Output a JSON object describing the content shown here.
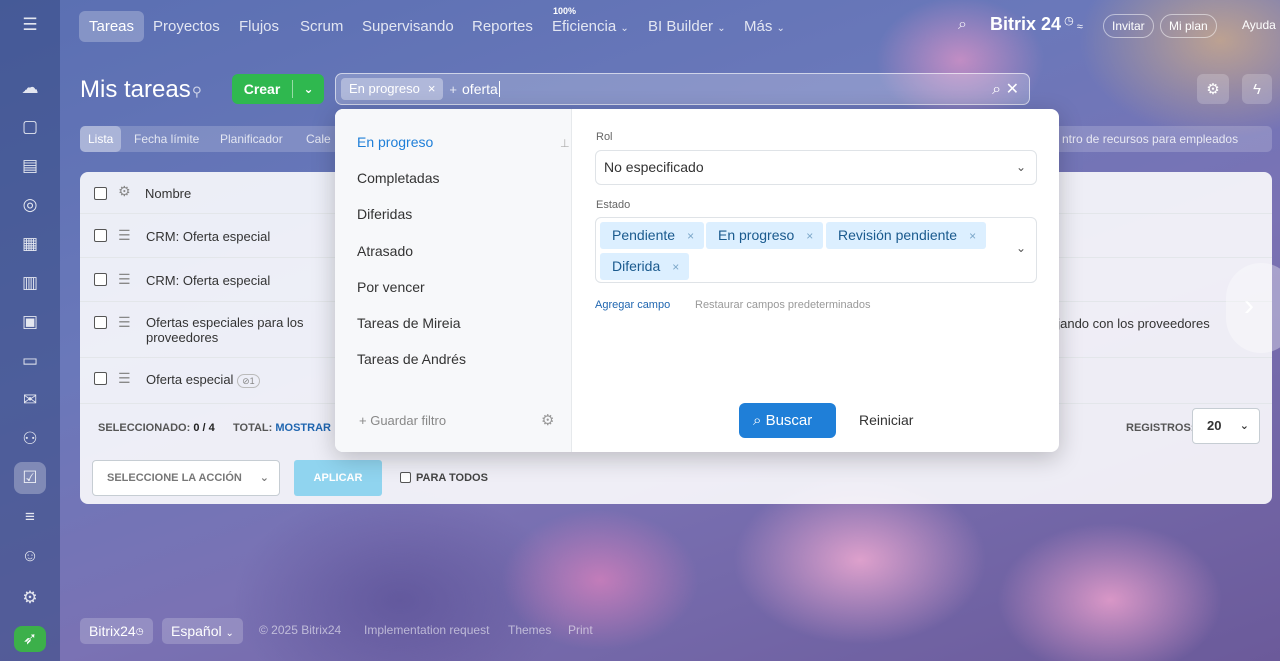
{
  "sidebar": {
    "icons": [
      "menu-icon",
      "chat-icon",
      "messages-icon",
      "feed-icon",
      "crm-icon",
      "calendar-icon",
      "docs-icon",
      "board-icon",
      "payment-icon",
      "mail-icon",
      "contacts-icon",
      "tasks-icon",
      "automation-icon",
      "robot-icon",
      "settings-icon",
      "launch-icon"
    ]
  },
  "topnav": {
    "items": [
      "Tareas",
      "Proyectos",
      "Flujos",
      "Scrum",
      "Supervisando",
      "Reportes",
      "Eficiencia",
      "BI Builder",
      "Más"
    ],
    "efficiency_badge": "100%",
    "brand": "Bitrix 24",
    "invite": "Invitar",
    "plan": "Mi plan",
    "help": "Ayuda"
  },
  "header": {
    "title": "Mis tareas",
    "create": "Crear"
  },
  "search": {
    "chip": "En progreso",
    "plus": "+",
    "query": "oferta"
  },
  "subtabs": {
    "items": [
      "Lista",
      "Fecha límite",
      "Planificador",
      "Cale"
    ],
    "right_text": "ntro de recursos para empleados"
  },
  "grid": {
    "header": "Nombre",
    "rows": [
      {
        "name": "CRM: Oferta especial"
      },
      {
        "name": "CRM: Oferta especial"
      },
      {
        "name": "Ofertas especiales para los proveedores"
      },
      {
        "name": "Oferta especial",
        "badge": "1"
      }
    ],
    "right_peek": "ajando con los proveedores",
    "selected_label": "SELECCIONADO:",
    "selected_value": "0 / 4",
    "total_label": "TOTAL:",
    "total_link": "MOSTRAR",
    "records_label": "REGISTROS:",
    "records_value": "20",
    "action_select": "SELECCIONE LA ACCIÓN",
    "apply": "APLICAR",
    "for_all": "PARA TODOS"
  },
  "filter": {
    "presets": [
      "En progreso",
      "Completadas",
      "Diferidas",
      "Atrasado",
      "Por vencer",
      "Tareas de Mireia",
      "Tareas de Andrés"
    ],
    "active_preset": "En progreso",
    "save_filter": "Guardar filtro",
    "role_label": "Rol",
    "role_value": "No especificado",
    "status_label": "Estado",
    "status_tags": [
      "Pendiente",
      "En progreso",
      "Revisión pendiente",
      "Diferida"
    ],
    "add_field": "Agregar campo",
    "restore_fields": "Restaurar campos predeterminados",
    "search_button": "Buscar",
    "reset_button": "Reiniciar"
  },
  "footer": {
    "brand": "Bitrix24",
    "language": "Español",
    "copyright": "© 2025 Bitrix24",
    "links": [
      "Implementation request",
      "Themes",
      "Print"
    ]
  },
  "colors": {
    "accent": "#1f7fd8",
    "create": "#2fb84f",
    "tag_bg": "#dcefff"
  }
}
